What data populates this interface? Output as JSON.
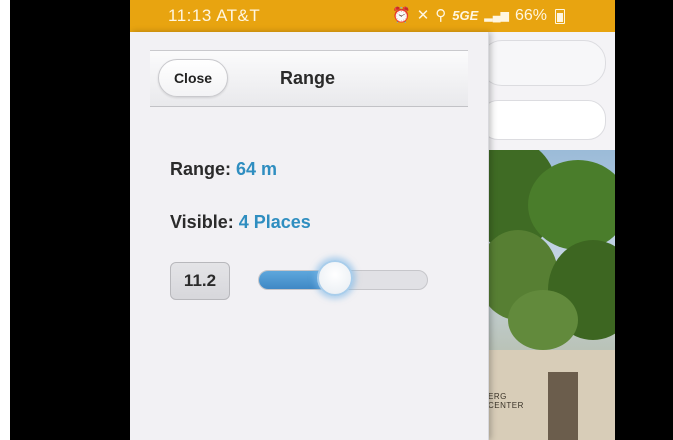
{
  "status_bar": {
    "time": "11:13",
    "carrier": "AT&T",
    "network": "5G",
    "network_suffix": "E",
    "battery": "66%",
    "icons": [
      "alarm-icon",
      "mute-icon",
      "location-icon",
      "signal-icon",
      "battery-icon"
    ],
    "background_color": "#e8a410"
  },
  "panel": {
    "close_label": "Close",
    "title": "Range",
    "range_label": "Range:",
    "range_value": "64 m",
    "visible_label": "Visible:",
    "visible_value": "4 Places",
    "slider_number": "11.2",
    "slider_level": 0.45,
    "accent_color": "#2f8ec0"
  },
  "camera_view": {
    "sign_text_line1": "ERG",
    "sign_text_line2": "CENTER"
  }
}
